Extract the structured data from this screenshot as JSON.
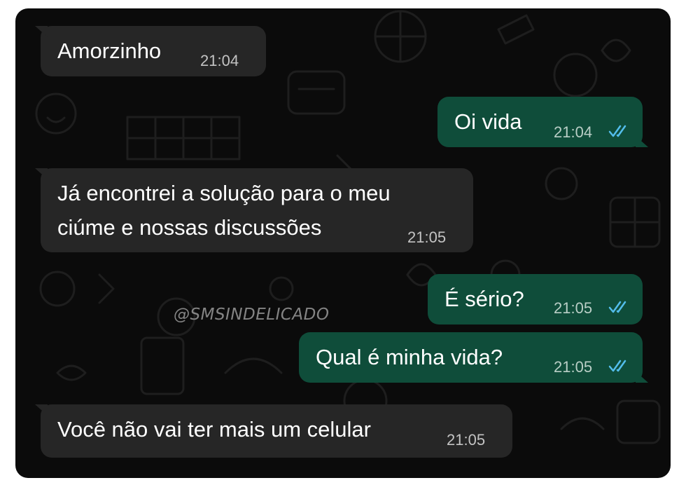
{
  "chat": {
    "messages": [
      {
        "direction": "incoming",
        "text": "Amorzinho",
        "time": "21:04"
      },
      {
        "direction": "outgoing",
        "text": "Oi vida",
        "time": "21:04",
        "status": "read-double-check"
      },
      {
        "direction": "incoming",
        "lines": [
          "Já encontrei a solução para o meu",
          "ciúme e nossas discussões"
        ],
        "time": "21:05"
      },
      {
        "direction": "outgoing",
        "text": "É sério?",
        "time": "21:05",
        "status": "read-double-check"
      },
      {
        "direction": "outgoing",
        "text": "Qual é minha vida?",
        "time": "21:05",
        "status": "read-double-check"
      },
      {
        "direction": "incoming",
        "text": "Você não vai ter mais um celular",
        "time": "21:05"
      }
    ]
  },
  "watermark": "@SMSINDELICADO",
  "colors": {
    "background": "#0b0b0b",
    "incoming_bubble": "#262626",
    "outgoing_bubble": "#0f4d3a",
    "read_ticks": "#53bdeb",
    "page": "#ffffff"
  },
  "icons": [
    "double-check-icon"
  ]
}
